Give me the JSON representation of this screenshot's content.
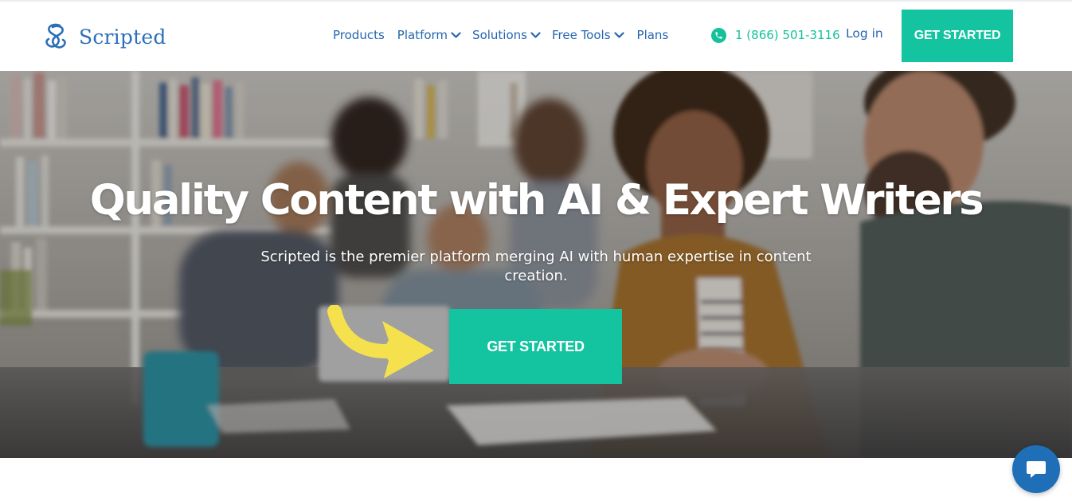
{
  "brand": {
    "name": "Scripted",
    "color": "#2c6fb8",
    "icon": "scripted-logo-icon"
  },
  "nav": {
    "items": [
      {
        "label": "Products",
        "dropdown": false
      },
      {
        "label": "Platform",
        "dropdown": true
      },
      {
        "label": "Solutions",
        "dropdown": true
      },
      {
        "label": "Free Tools",
        "dropdown": true
      },
      {
        "label": "Plans",
        "dropdown": false
      }
    ],
    "phone": "1 (866) 501-3116",
    "phone_icon": "phone-icon",
    "login": "Log in",
    "cta": "GET STARTED"
  },
  "hero": {
    "title": "Quality Content with AI & Expert Writers",
    "subtitle": "Scripted is the premier platform merging AI with human expertise in content creation.",
    "cta": "GET STARTED",
    "arrow_icon": "curved-arrow-icon",
    "arrow_color": "#f5e14e"
  },
  "chat": {
    "icon": "chat-bubble-icon"
  },
  "colors": {
    "accent": "#14c3a0",
    "link": "#2566b0",
    "phone": "#14c199"
  }
}
